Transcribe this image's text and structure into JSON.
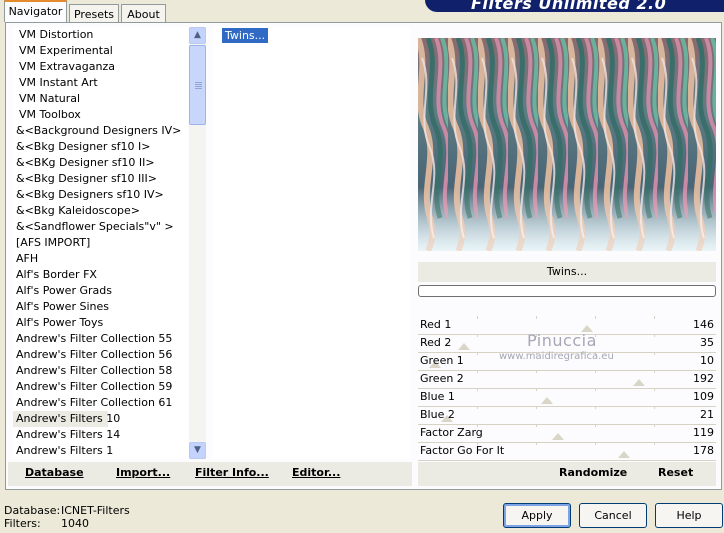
{
  "tabs": [
    {
      "label": "Navigator",
      "active": true
    },
    {
      "label": "Presets",
      "active": false
    },
    {
      "label": "About",
      "active": false
    }
  ],
  "brand": "Filters Unlimited 2.0",
  "categories": [
    "VM Distortion",
    "VM Experimental",
    "VM Extravaganza",
    "VM Instant Art",
    "VM Natural",
    "VM Toolbox",
    "&<Background Designers IV>",
    "&<Bkg Designer sf10 I>",
    "&<BKg Designer sf10 II>",
    "&<Bkg Designer sf10 III>",
    "&<Bkg Designers sf10 IV>",
    "&<Bkg Kaleidoscope>",
    "&<Sandflower Specials\"v\" >",
    "[AFS IMPORT]",
    "AFH",
    "Alf's Border FX",
    "Alf's Power Grads",
    "Alf's Power Sines",
    "Alf's Power Toys",
    "Andrew's Filter Collection 55",
    "Andrew's Filter Collection 56",
    "Andrew's Filter Collection 58",
    "Andrew's Filter Collection 59",
    "Andrew's Filter Collection 61",
    "Andrew's Filters 10",
    "Andrew's Filters 14",
    "Andrew's Filters 1"
  ],
  "selected_category": "Andrew's Filters 10",
  "filters": [
    "Twins..."
  ],
  "selected_filter": "Twins...",
  "preview_filter_name": "Twins...",
  "watermark": {
    "line1": "Pinuccia",
    "line2": "www.maidiregrafica.eu"
  },
  "sliders": [
    {
      "label": "Red 1",
      "value": "146",
      "fraction": 0.57
    },
    {
      "label": "Red 2",
      "value": "35",
      "fraction": 0.14
    },
    {
      "label": "Green 1",
      "value": "10",
      "fraction": 0.04
    },
    {
      "label": "Green 2",
      "value": "192",
      "fraction": 0.75
    },
    {
      "label": "Blue 1",
      "value": "109",
      "fraction": 0.43
    },
    {
      "label": "Blue 2",
      "value": "21",
      "fraction": 0.08
    },
    {
      "label": "Factor Zarg",
      "value": "119",
      "fraction": 0.47
    },
    {
      "label": "Factor Go For It",
      "value": "178",
      "fraction": 0.7
    }
  ],
  "toolbar": {
    "database": "Database",
    "import": "Import...",
    "filter_info": "Filter Info...",
    "editor": "Editor..."
  },
  "actions": {
    "randomize": "Randomize",
    "reset": "Reset"
  },
  "status": {
    "database_label": "Database:",
    "database_value": "ICNET-Filters",
    "filters_label": "Filters:",
    "filters_value": "1040"
  },
  "buttons": {
    "apply": "Apply",
    "cancel": "Cancel",
    "help": "Help"
  }
}
